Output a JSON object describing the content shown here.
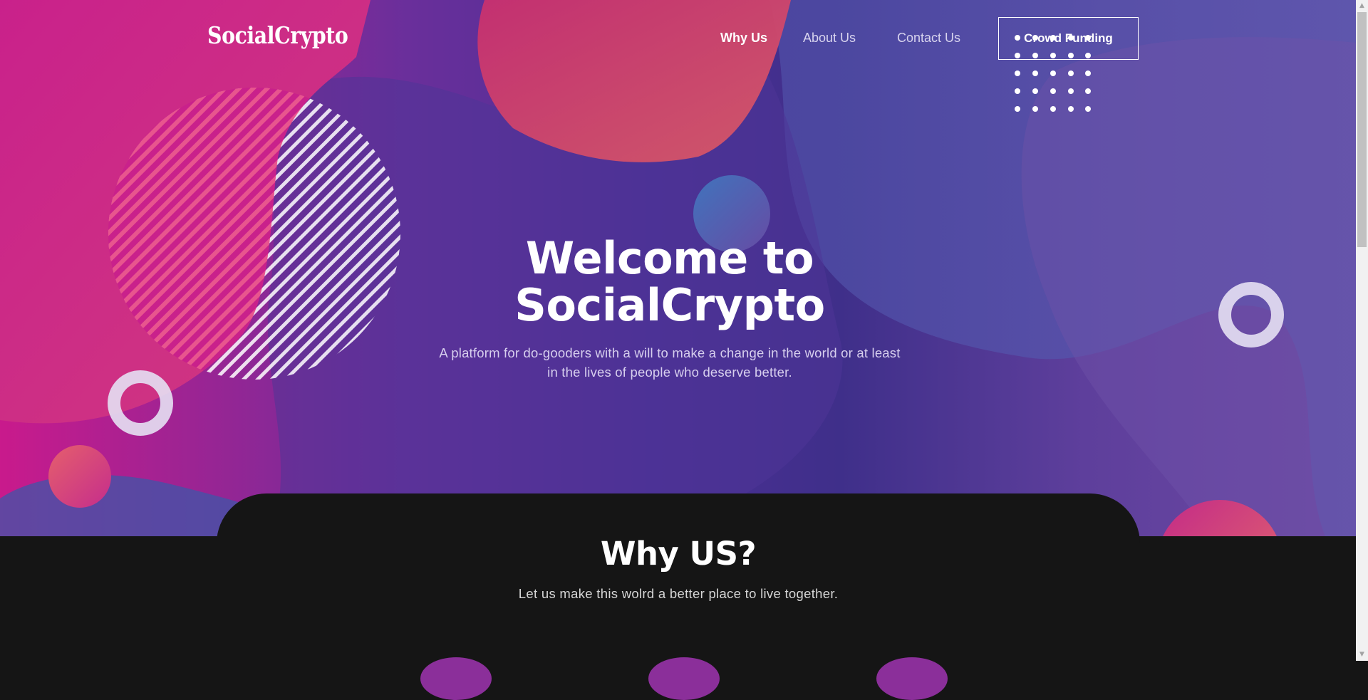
{
  "brand": {
    "logo": "SocialCrypto"
  },
  "nav": {
    "links": [
      {
        "label": "Why Us"
      },
      {
        "label": "About Us"
      },
      {
        "label": "Contact Us"
      }
    ],
    "cta_label": "Crowd Funding"
  },
  "hero": {
    "title_line1": "Welcome to",
    "title_line2": "SocialCrypto",
    "subtitle_line1": "A platform for do-gooders with a will to make a change in the world or at least",
    "subtitle_line2": "in the lives of people who deserve better."
  },
  "why_us": {
    "title": "Why US?",
    "subtitle": "Let us make this wolrd a better place to live together."
  },
  "colors": {
    "hero_pink": "#c91a8c",
    "hero_purple": "#4b2f94",
    "section_bg": "#151515",
    "text_white": "#ffffff"
  },
  "icons": {
    "scroll_up": "triangle-up",
    "scroll_down": "triangle-down"
  }
}
